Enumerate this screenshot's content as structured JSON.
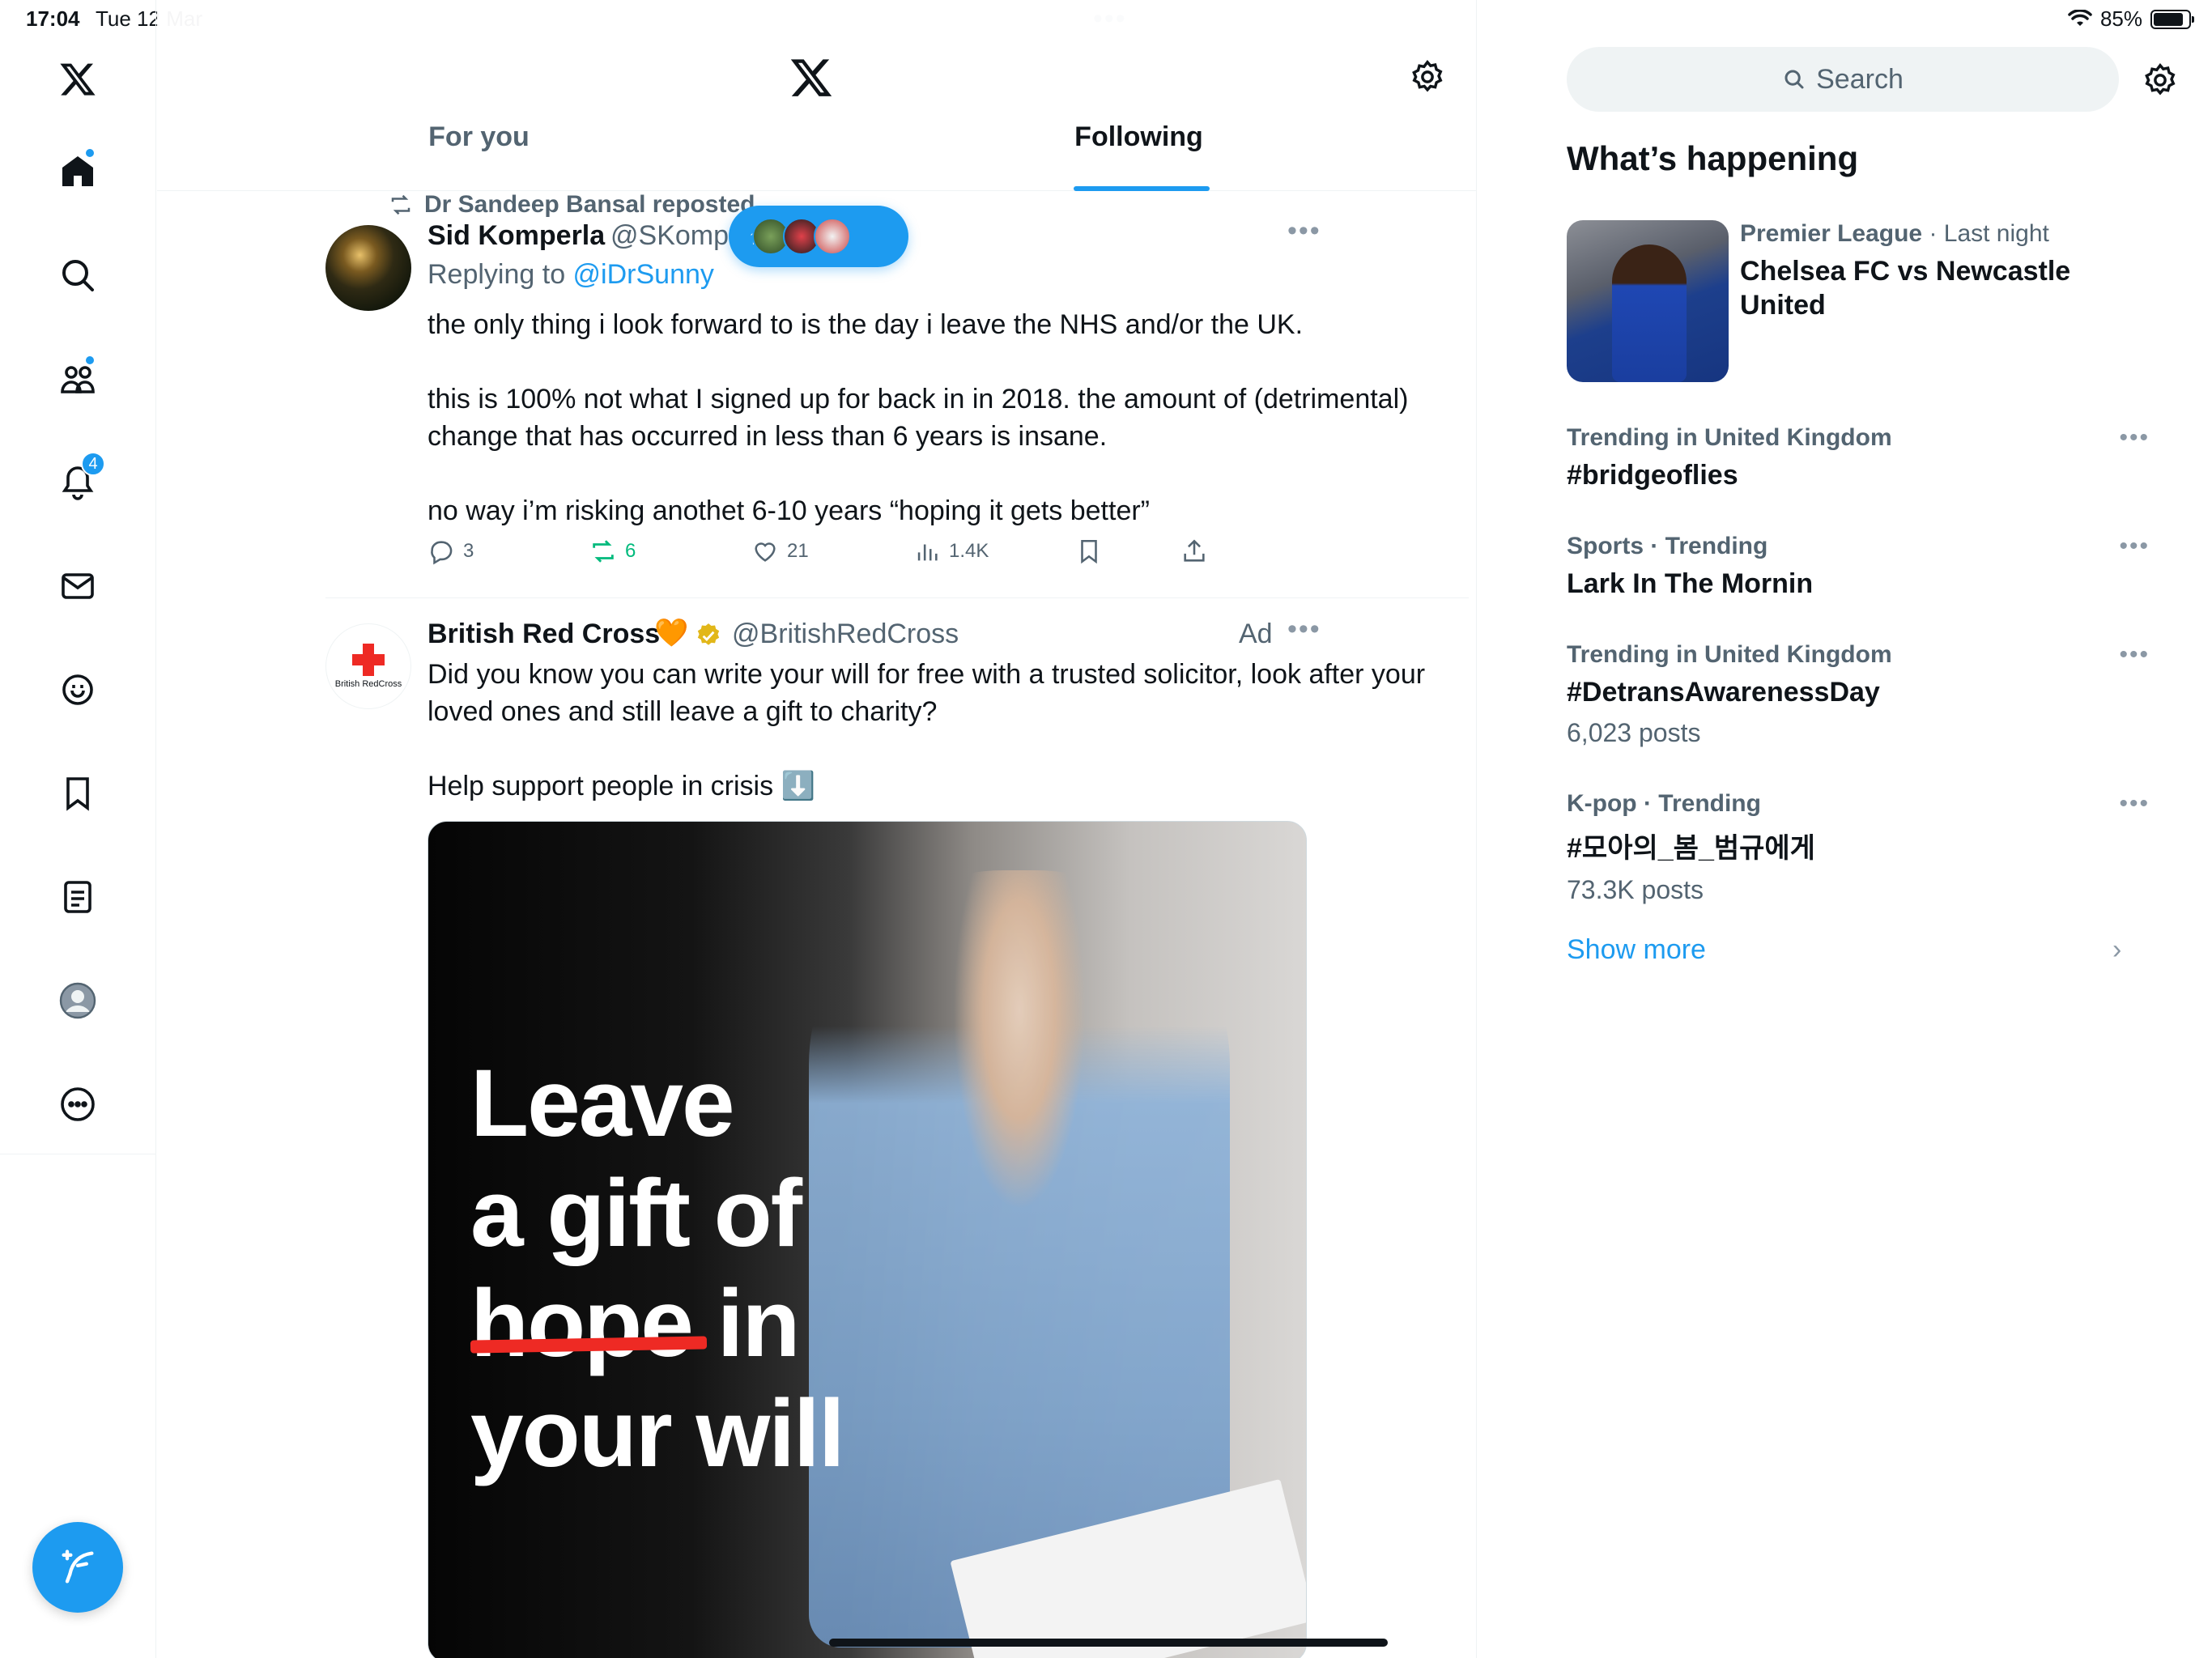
{
  "status": {
    "time": "17:04",
    "date": "Tue 12 Mar",
    "battery": "85%",
    "battery_level": 0.85
  },
  "nav": {
    "items": [
      "x-logo",
      "home-icon",
      "search-icon",
      "communities-icon",
      "notifications-icon",
      "messages-icon",
      "grok-icon",
      "bookmarks-icon",
      "lists-icon",
      "profile-icon",
      "more-icon"
    ],
    "notifications_badge": "4"
  },
  "header": {
    "tabs": [
      {
        "label": "For you",
        "active": false
      },
      {
        "label": "Following",
        "active": true
      }
    ]
  },
  "feed": {
    "new_posts_arrow": "↑",
    "tweet1": {
      "repost_by": "Dr Sandeep Bansal reposted",
      "name": "Sid Komperla",
      "handle": "@SKompe",
      "replying_prefix": "Replying to ",
      "replying_to": "@iDrSunny",
      "body": "the only thing i look forward to is the day i leave the NHS and/or the UK.\n\nthis is 100% not what I signed up for back in in 2018. the amount of (detrimental) change that has occurred in less than 6 years is insane.\n\nno way i’m risking anothet 6-10 years “hoping it gets better”",
      "replies": "3",
      "reposts": "6",
      "likes": "21",
      "views": "1.4K"
    },
    "tweet2": {
      "name": "British Red Cross",
      "emoji": "🧡",
      "handle": "@BritishRedCross",
      "ad_label": "Ad",
      "avatar_text": "British RedCross",
      "body": "Did you know you can write your will for free with a trusted solicitor, look after your loved ones and still leave a gift to charity?\n\nHelp support people in crisis ⬇️",
      "ad_headline": [
        "Leave",
        "a gift of",
        "hope in",
        "your will"
      ]
    }
  },
  "sidebar": {
    "search_placeholder": "Search",
    "title": "What’s happening",
    "news": {
      "category": "Premier League",
      "time": " · Last night",
      "title": "Chelsea FC vs Newcastle United"
    },
    "trends": [
      {
        "category": "Trending in United Kingdom",
        "name": "#bridgeoflies",
        "posts": ""
      },
      {
        "category": "Sports · Trending",
        "name": "Lark In The Mornin",
        "posts": ""
      },
      {
        "category": "Trending in United Kingdom",
        "name": "#DetransAwarenessDay",
        "posts": "6,023 posts"
      },
      {
        "category": "K-pop · Trending",
        "name": "#모아의_봄_범규에게",
        "posts": "73.3K posts"
      }
    ],
    "show_more": "Show more"
  },
  "colors": {
    "accent": "#1d9bf0",
    "repost_green": "#00ba7c",
    "secondary_text": "#536471",
    "red_cross": "#ee2a24"
  }
}
